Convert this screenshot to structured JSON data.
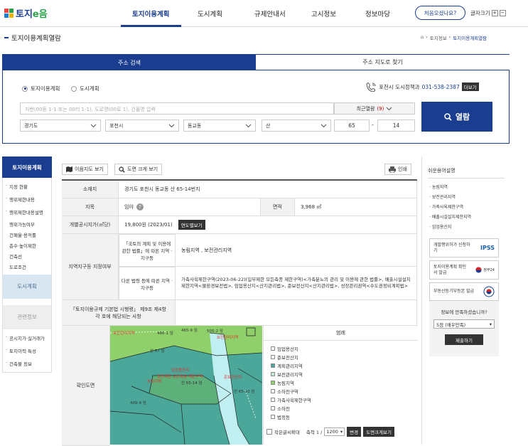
{
  "header": {
    "logo_text": "토지",
    "logo_suffix": "e음",
    "nav": [
      "토지이용계획",
      "도시계획",
      "규제안내서",
      "고시정보",
      "정보마당"
    ],
    "first_visit": "처음오셨나요?",
    "font_size_label": "글자크기",
    "font_plus": "+",
    "font_minus": "−"
  },
  "page": {
    "title": "토지이용계획열람",
    "breadcrumb": [
      "토지정보",
      "토지이용계획열람"
    ]
  },
  "search": {
    "tabs": [
      "주소 검색",
      "주소 지도로 찾기"
    ],
    "radio": [
      "토지이용계획",
      "도시계획"
    ],
    "office": "포천시 도시정책과",
    "phone": "031-538-2387",
    "more": "더보기",
    "address_placeholder": "지번(00동 1-1 또는 00리 1-1), 도로명(00로 1), 건물명 입력",
    "recent_label": "최근열람",
    "recent_count": "(9)",
    "province": "경기도",
    "city": "포천시",
    "town": "동교동",
    "land_type": "산",
    "main_no": "65",
    "dash": "-",
    "sub_no": "14",
    "view_button": "열람"
  },
  "left_nav": {
    "head": "토지이용계획",
    "items": [
      "지정 현황",
      "행위제한내용",
      "행위제한내용설명"
    ],
    "subs": [
      "행위가능여부",
      "건폐율·용적률",
      "층수·높이제한",
      "건축선",
      "도로조건"
    ],
    "block1": "도시계획",
    "block2": "관련정보",
    "items2": [
      "공시지가·실거래가",
      "토지이력·특성",
      "건축물 정보"
    ]
  },
  "toolbar": {
    "map_view": "이음지도 보기",
    "zoom_view": "도면 크게 보기",
    "print": "인쇄"
  },
  "table": {
    "location_label": "소재지",
    "location": "경기도 포천시 동교동 산 65-14번지",
    "jimok_label": "지목",
    "jimok": "임야",
    "jimok_help": "?",
    "area_label": "면적",
    "area": "3,968 ㎡",
    "price_label": "개별공시지가(㎡당)",
    "price": "19,800원 (2023/01)",
    "price_btn": "연도별보기",
    "zone_label": "지역지구등 지정여부",
    "zone_law1_label": "「국토의 계획 및 이용에 관한 법률」에 따른 지역 · 지구등",
    "zone_law1": "농림지역 , 보전관리지역",
    "zone_law2_label": "다른 법령 등에 따른 지역 · 지구등",
    "zone_law2": "가축사육제한구역(2023-06-22)(일부제한 모든축종 제한구역)<가축분뇨의 관리 및 이용에 관한 법률>, 배출시설설치제한지역<물환경보전법>, 임업용산지<산지관리법>, 준보전산지<산지관리법>, 성장관리권역<수도권정비계획법>",
    "rule_label": "「토지이용규제 기본법 시행령」 제9조 제4항 각 호에 해당되는 사항",
    "rule_value": "",
    "map_label": "확인도면"
  },
  "map": {
    "labels": [
      "보전관리지역",
      "486-1 임",
      "465-9 임",
      "505-2 임",
      "산 57 임",
      "임업용산지",
      "일부제한 모든축종 제한구역",
      "준보전산지",
      "농림지역",
      "산 65-14 임",
      "산 65-10 임",
      "409-9 임",
      "보전관리지역"
    ]
  },
  "legend": {
    "title": "범례",
    "items": [
      "임업용산지",
      "준보전산지",
      "계획관리지역",
      "보전관리지역",
      "농림지역",
      "소하천구역",
      "가축사육제한구역",
      "소하천",
      "법정동"
    ],
    "colors": [
      "#ffffff",
      "#ffffff",
      "#4aa79a",
      "#c8ead0",
      "#8fd06a",
      "#ffffff",
      "#ffffff",
      "#ffffff",
      "#ffffff"
    ]
  },
  "map_bar": {
    "small_label": "작은글씨확대",
    "scale_label": "축척 1 /",
    "scale": "1200",
    "change": "변경",
    "big_view": "도면크게보기"
  },
  "right": {
    "title": "쉬운용어설명",
    "terms": [
      "농림지역",
      "보전관리지역",
      "가축사육제한구역",
      "배출시설설치제한지역",
      "임업용산지"
    ],
    "banner1": "개발행위허가 신청하기",
    "banner1_logo": "IPSS",
    "banner2": "토지이용계획 확인서 발급",
    "banner2_logo": "정부24",
    "banner3": "부동산등기부등본 발급",
    "survey_q": "정보에 만족하셨습니까?",
    "survey_opt": "5점 (매우만족)",
    "survey_btn": "제출하기"
  }
}
